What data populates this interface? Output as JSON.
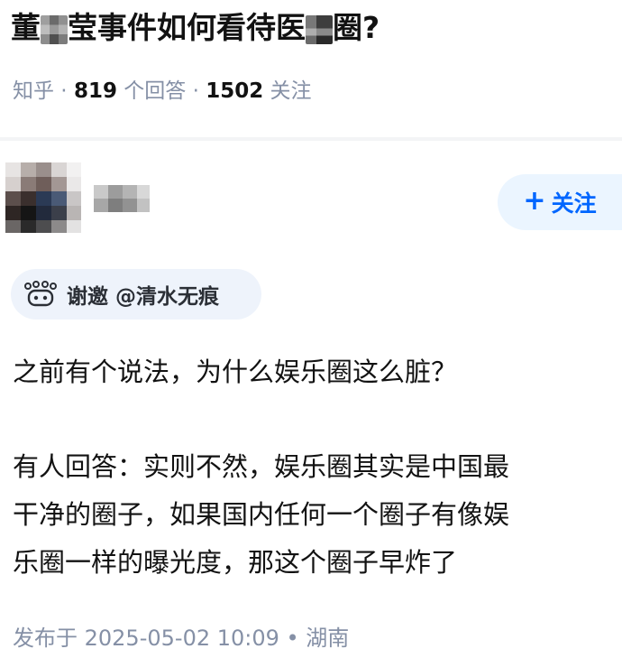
{
  "question": {
    "title_part1": "董",
    "title_part2": "莹事件如何看待医",
    "title_part3": "圈?",
    "meta_site": "知乎 · ",
    "answer_count": "819",
    "answer_label": " 个回答 · ",
    "follower_count": "1502",
    "follower_label": " 关注"
  },
  "answer_header": {
    "follow_button_plus": "+",
    "follow_button_label": "关注",
    "invite_text": "谢邀 @清水无痕"
  },
  "content": {
    "line1": "之前有个说法，为什么娱乐圈这么脏？",
    "line2": "有人回答：实则不然，娱乐圈其实是中国最",
    "line3": "干净的圈子，如果国内任何一个圈子有像娱",
    "line4": "乐圈一样的曝光度，那这个圈子早炸了"
  },
  "post_meta": {
    "text": "发布于 2025-05-02 10:09 • 湖南"
  },
  "colors": {
    "accent": "#0066ff",
    "muted": "#8590a6",
    "follow_bg": "#ebf5ff",
    "invite_bg": "#eef3fb"
  }
}
